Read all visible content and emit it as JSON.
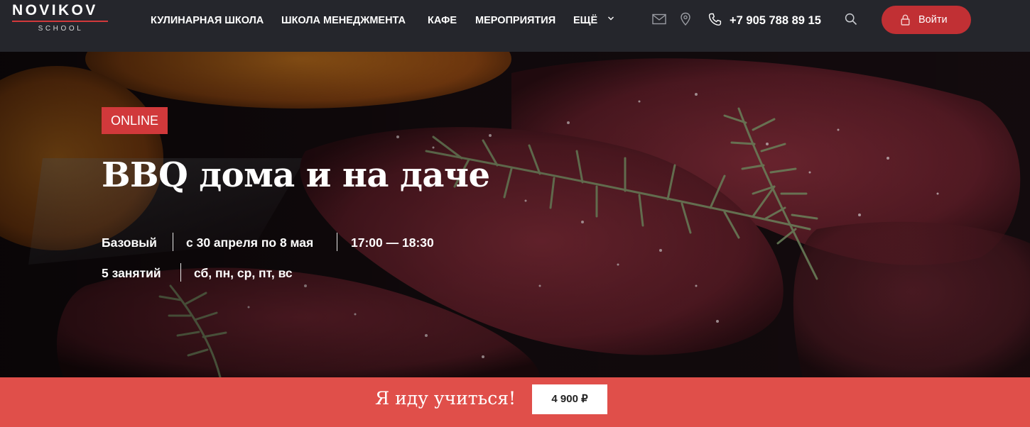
{
  "header": {
    "logo": {
      "name": "NOVIKOV",
      "sub": "SCHOOL"
    },
    "nav": [
      {
        "label": "КУЛИНАРНАЯ ШКОЛА"
      },
      {
        "label": "ШКОЛА МЕНЕДЖМЕНТА"
      },
      {
        "label": "КАФЕ"
      },
      {
        "label": "МЕРОПРИЯТИЯ"
      },
      {
        "label": "ЕЩЁ"
      }
    ],
    "phone": "+7 905 788 89 15",
    "login_label": "Войти",
    "icons": [
      "mail-icon",
      "location-pin-icon",
      "phone-icon",
      "search-icon",
      "lock-icon",
      "chevron-down-icon"
    ]
  },
  "hero": {
    "badge": "ONLINE",
    "title": "BBQ дома и на даче",
    "level": "Базовый",
    "dates": "с 30 апреля по 8 мая",
    "time": "17:00 — 18:30",
    "lessons": "5 занятий",
    "days": "сб, пн, ср, пт, вс"
  },
  "cta": {
    "label": "Я иду учиться!",
    "price": "4 900 ₽"
  },
  "colors": {
    "header_bg": "#25262c",
    "accent_red": "#d1393b",
    "button_red": "#c13034",
    "cta_bar": "#e04f4a"
  }
}
